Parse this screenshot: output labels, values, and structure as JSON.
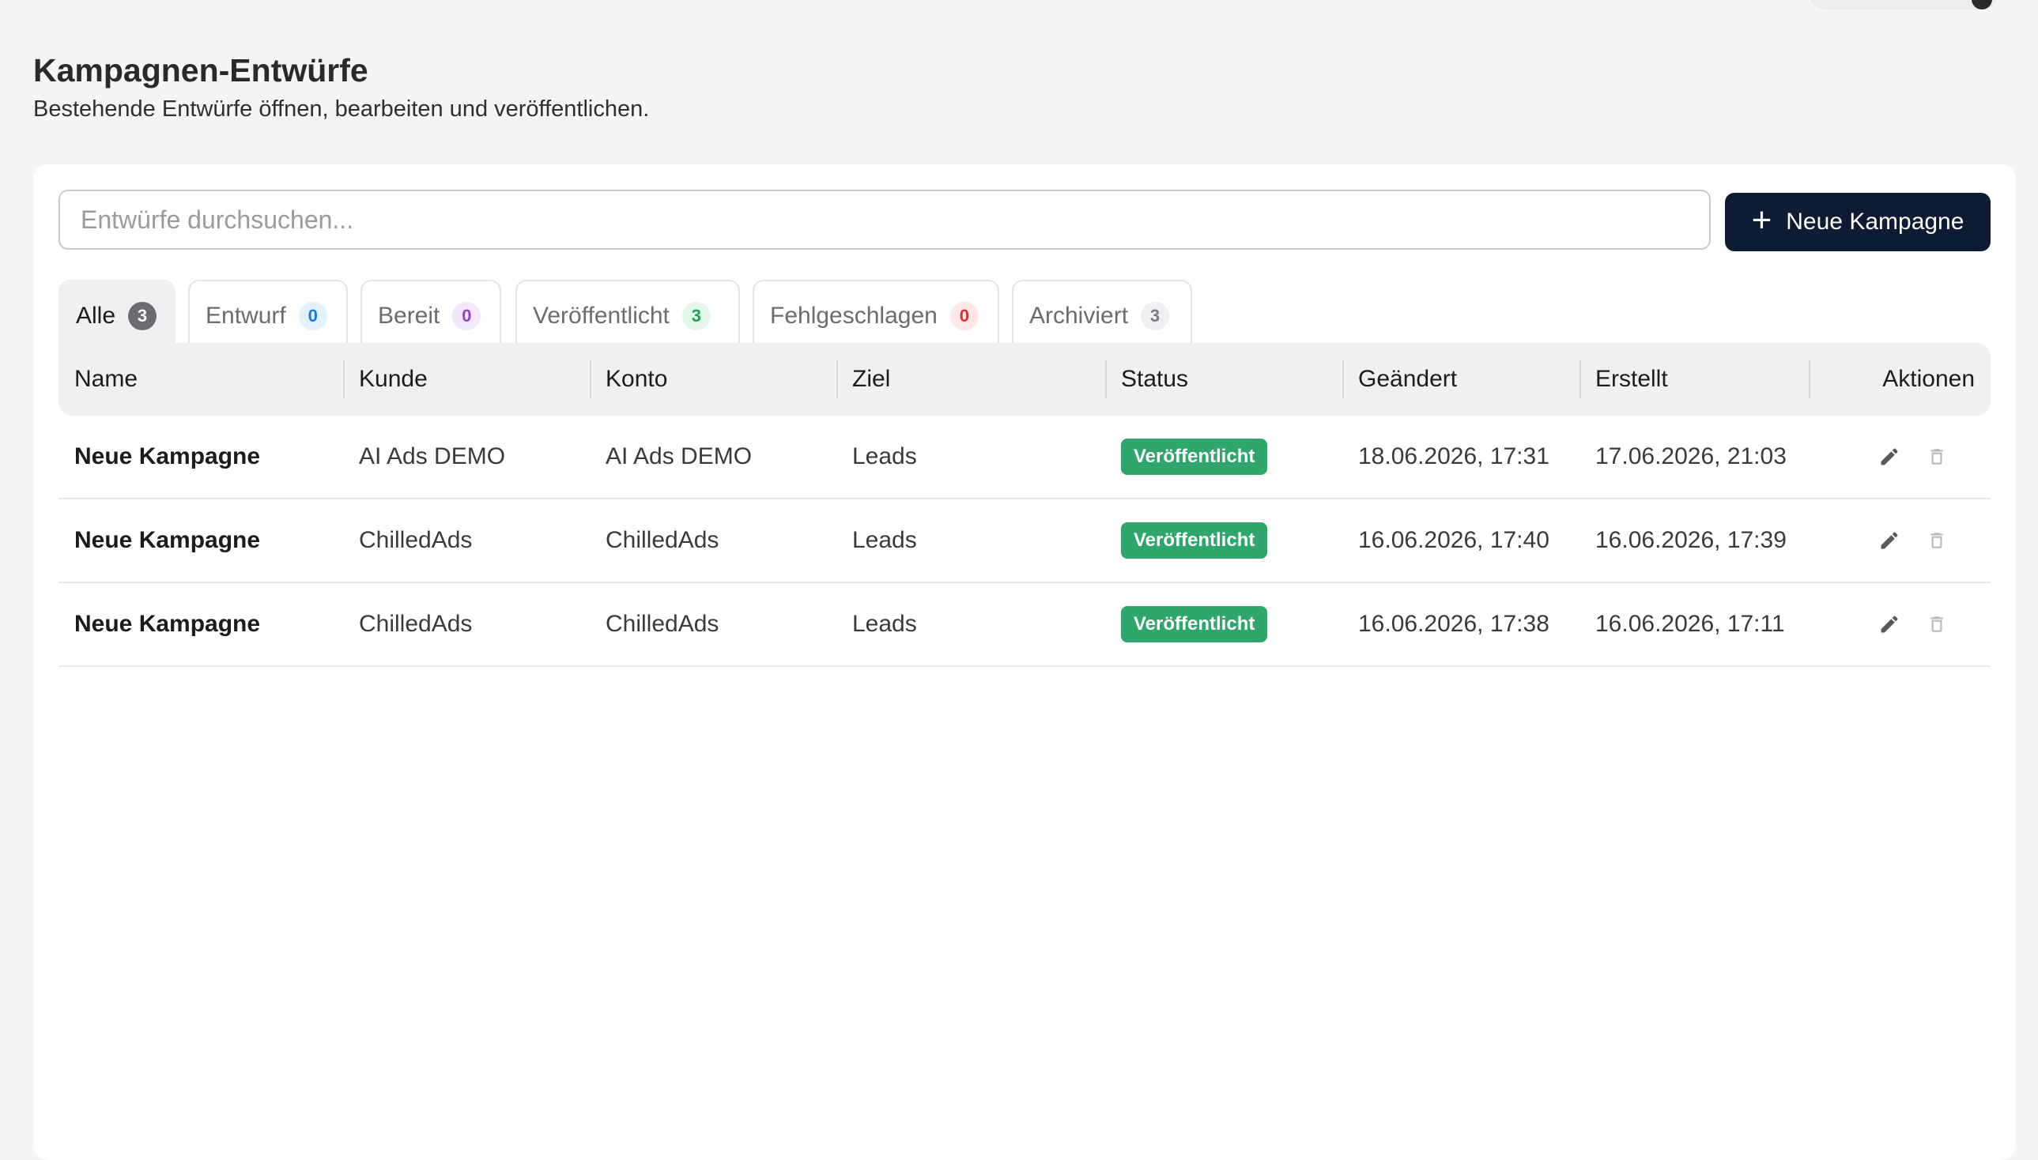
{
  "header": {
    "title": "Kampagnen-Entwürfe",
    "subtitle": "Bestehende Entwürfe öffnen, bearbeiten und veröffentlichen."
  },
  "search": {
    "placeholder": "Entwürfe durchsuchen...",
    "value": ""
  },
  "new_button": {
    "label": "Neue Kampagne",
    "icon": "plus-icon"
  },
  "tabs": [
    {
      "label": "Alle",
      "count": "3",
      "active": true,
      "badge_bg": "#6b6b70",
      "badge_fg": "#ffffff"
    },
    {
      "label": "Entwurf",
      "count": "0",
      "active": false,
      "badge_bg": "#e3f0fd",
      "badge_fg": "#1a7bd6"
    },
    {
      "label": "Bereit",
      "count": "0",
      "active": false,
      "badge_bg": "#f3e8fb",
      "badge_fg": "#9b3fc8"
    },
    {
      "label": "Veröffentlicht",
      "count": "3",
      "active": false,
      "badge_bg": "#e2f6ea",
      "badge_fg": "#23a05c"
    },
    {
      "label": "Fehlgeschlagen",
      "count": "0",
      "active": false,
      "badge_bg": "#fde7e7",
      "badge_fg": "#d62f2f"
    },
    {
      "label": "Archiviert",
      "count": "3",
      "active": false,
      "badge_bg": "#f0f0f2",
      "badge_fg": "#7a7a7f"
    }
  ],
  "table": {
    "columns": [
      "Name",
      "Kunde",
      "Konto",
      "Ziel",
      "Status",
      "Geändert",
      "Erstellt",
      "Aktionen"
    ],
    "rows": [
      {
        "name": "Neue Kampagne",
        "kunde": "AI Ads DEMO",
        "konto": "AI Ads DEMO",
        "ziel": "Leads",
        "status": "Veröffentlicht",
        "geaendert": "18.06.2026, 17:31",
        "erstellt": "17.06.2026, 21:03"
      },
      {
        "name": "Neue Kampagne",
        "kunde": "ChilledAds",
        "konto": "ChilledAds",
        "ziel": "Leads",
        "status": "Veröffentlicht",
        "geaendert": "16.06.2026, 17:40",
        "erstellt": "16.06.2026, 17:39"
      },
      {
        "name": "Neue Kampagne",
        "kunde": "ChilledAds",
        "konto": "ChilledAds",
        "ziel": "Leads",
        "status": "Veröffentlicht",
        "geaendert": "16.06.2026, 17:38",
        "erstellt": "16.06.2026, 17:11"
      }
    ],
    "action_icons": [
      "pencil-icon",
      "trash-icon"
    ]
  },
  "colors": {
    "accent": "#0d1b33",
    "status_published": "#2ea66c",
    "page_bg": "#f5f5f7",
    "header_bg": "#f0f0f2"
  }
}
